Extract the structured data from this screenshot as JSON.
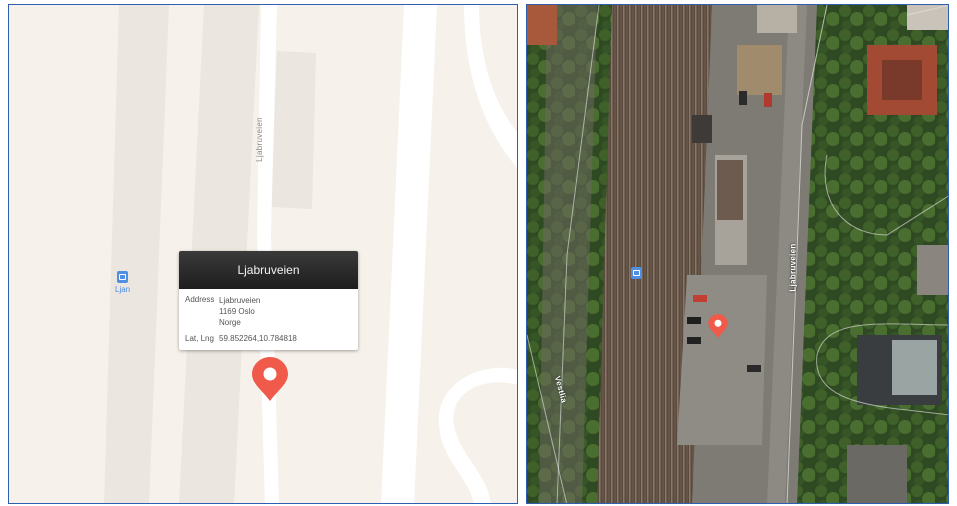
{
  "left_map": {
    "road_label": "Ljabruveien",
    "transit_label": "Ljan",
    "transit_icon": "train-station-icon",
    "marker_icon": "location-pin-icon"
  },
  "callout": {
    "title": "Ljabruveien",
    "address_key": "Address",
    "address_line1": "Ljabruveien",
    "address_line2": "1169 Oslo",
    "address_line3": "Norge",
    "latlng_key": "Lat, Lng",
    "latlng_value": "59.852264,10.784818"
  },
  "right_map": {
    "road_label_main": "Ljabruveien",
    "road_label_side": "Vestlia",
    "transit_icon": "train-station-icon",
    "marker_icon": "location-pin-icon"
  },
  "colors": {
    "accent_marker": "#f05a4a",
    "transit_blue": "#4f8ee0",
    "frame_border": "#2f5fae"
  }
}
